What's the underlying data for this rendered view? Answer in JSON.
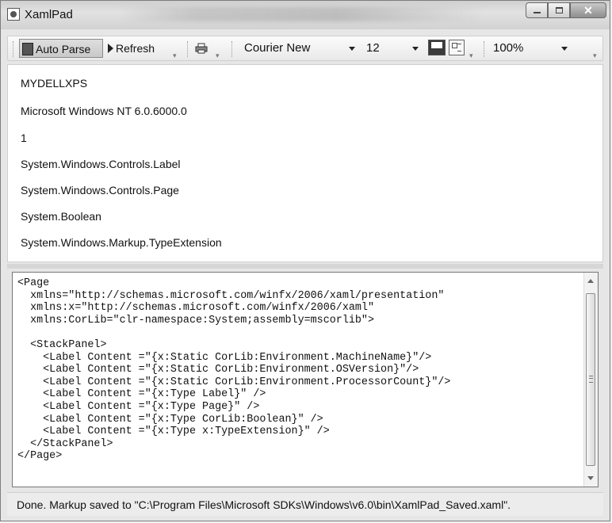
{
  "window": {
    "title": "XamlPad"
  },
  "toolbar": {
    "auto_parse_label": "Auto Parse",
    "refresh_label": "Refresh",
    "font_family": "Courier New",
    "font_size": "12",
    "zoom": "100%"
  },
  "output": {
    "lines": [
      "MYDELLXPS",
      "Microsoft Windows NT 6.0.6000.0",
      "1",
      "System.Windows.Controls.Label",
      "System.Windows.Controls.Page",
      "System.Boolean",
      "System.Windows.Markup.TypeExtension"
    ]
  },
  "editor": {
    "code": "<Page\n  xmlns=\"http://schemas.microsoft.com/winfx/2006/xaml/presentation\"\n  xmlns:x=\"http://schemas.microsoft.com/winfx/2006/xaml\"\n  xmlns:CorLib=\"clr-namespace:System;assembly=mscorlib\">\n\n  <StackPanel>\n    <Label Content =\"{x:Static CorLib:Environment.MachineName}\"/>\n    <Label Content =\"{x:Static CorLib:Environment.OSVersion}\"/>\n    <Label Content =\"{x:Static CorLib:Environment.ProcessorCount}\"/>\n    <Label Content =\"{x:Type Label}\" />\n    <Label Content =\"{x:Type Page}\" />\n    <Label Content =\"{x:Type CorLib:Boolean}\" />\n    <Label Content =\"{x:Type x:TypeExtension}\" />\n  </StackPanel>\n</Page>"
  },
  "status": {
    "text": "Done. Markup saved to \"C:\\Program Files\\Microsoft SDKs\\Windows\\v6.0\\bin\\XamlPad_Saved.xaml\"."
  }
}
